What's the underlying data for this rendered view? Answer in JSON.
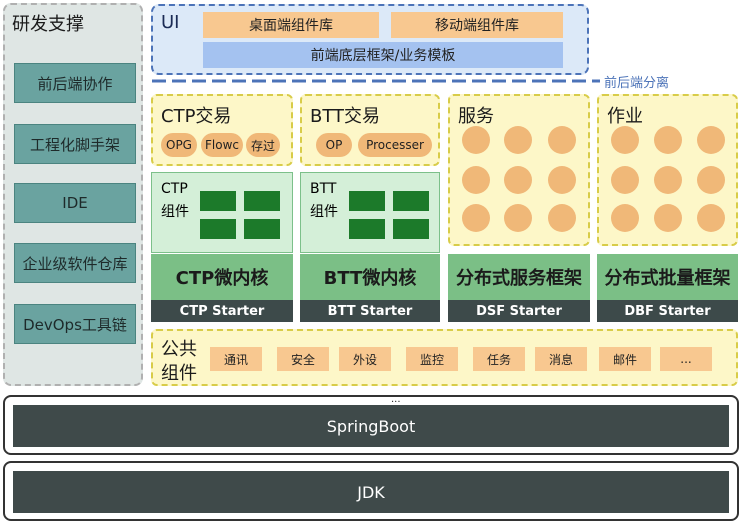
{
  "left": {
    "title": "研发支撑",
    "items": [
      "前后端协作",
      "工程化脚手架",
      "IDE",
      "企业级软件仓库",
      "DevOps工具链"
    ]
  },
  "ui": {
    "label": "UI",
    "desktop": "桌面端组件库",
    "mobile": "移动端组件库",
    "base": "前端底层框架/业务模板",
    "separator": "前后端分离"
  },
  "columns": {
    "ctp": {
      "title": "CTP交易",
      "pills": [
        "OPG",
        "Flowc",
        "存过"
      ],
      "comp_label": [
        "CTP",
        "组件"
      ],
      "kernel": "CTP微内核",
      "starter": "CTP Starter"
    },
    "btt": {
      "title": "BTT交易",
      "pills": [
        "OP",
        "Processer"
      ],
      "comp_label": [
        "BTT",
        "组件"
      ],
      "kernel": "BTT微内核",
      "starter": "BTT Starter"
    },
    "service": {
      "title": "服务",
      "kernel": "分布式服务框架",
      "starter": "DSF Starter"
    },
    "job": {
      "title": "作业",
      "kernel": "分布式批量框架",
      "starter": "DBF Starter"
    }
  },
  "common": {
    "label": [
      "公共",
      "组件"
    ],
    "items": [
      "通讯",
      "安全",
      "外设",
      "监控",
      "任务",
      "消息",
      "邮件",
      "..."
    ]
  },
  "platform": {
    "springboot": "SpringBoot",
    "springboot_dots": "...",
    "jdk": "JDK"
  },
  "colors": {
    "peach": "#f8c890",
    "dark_green": "#1c7a2a",
    "kernel_green": "#7bbf86",
    "starter_dark": "#3d4a4a",
    "tool_teal": "#6aa3a0",
    "separator_blue": "#4c73b8"
  }
}
